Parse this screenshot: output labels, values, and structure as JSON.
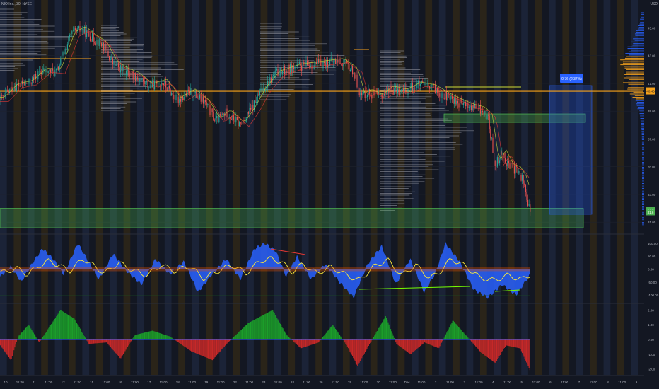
{
  "symbol_label": "NIO Inc., 30, NYSE",
  "currency": "USD",
  "price_axis": [
    {
      "v": 45,
      "label": "45.00"
    },
    {
      "v": 43,
      "label": "43.00"
    },
    {
      "v": 41,
      "label": "41.00"
    },
    {
      "v": 39,
      "label": "39.00"
    },
    {
      "v": 37,
      "label": "37.00"
    },
    {
      "v": 35,
      "label": "35.00"
    },
    {
      "v": 33,
      "label": "33.00"
    },
    {
      "v": 31,
      "label": "31.00"
    }
  ],
  "osc_axis": [
    {
      "v": 100,
      "label": "100.00"
    },
    {
      "v": 50,
      "label": "50.00"
    },
    {
      "v": 0,
      "label": "0.00"
    },
    {
      "v": -50,
      "label": "-50.00"
    },
    {
      "v": -100,
      "label": "-100.00"
    }
  ],
  "hist_axis": [
    {
      "v": 2,
      "label": "2.00"
    },
    {
      "v": 1,
      "label": "1.00"
    },
    {
      "v": 0,
      "label": "0.00"
    },
    {
      "v": -1,
      "label": "-1.00"
    },
    {
      "v": -2,
      "label": "-2.00"
    }
  ],
  "time_axis": [
    "10",
    "11:00",
    "11",
    "11:00",
    "12",
    "11:00",
    "15",
    "11:00",
    "16",
    "11:00",
    "17",
    "11:00",
    "18",
    "11:00",
    "19",
    "11:00",
    "22",
    "11:00",
    "23",
    "11:00",
    "24",
    "11:00",
    "26",
    "11:00",
    "29",
    "11:00",
    "30",
    "11:00",
    "Dec",
    "11:00",
    "2",
    "11:00",
    "3",
    "11:00",
    "4",
    "11:00",
    "5",
    "11:00",
    "6",
    "11:00",
    "7",
    "11:00",
    "8",
    "11:00",
    "9"
  ],
  "last_price": {
    "label": "40.46",
    "value": 40.46
  },
  "tag_price": {
    "label": "31.9",
    "value": 31.9
  },
  "tag_price2": {
    "label": "31.6",
    "value": 31.6
  },
  "position_label": "0.76 (2.37%)",
  "colors": {
    "up": "#26a69a",
    "down": "#ef5350",
    "level": "#f7a21b",
    "zone": "#4caf50",
    "profile": "#9598a1",
    "osc_blue": "#2962ff",
    "osc_yellow": "#ffeb3b",
    "hist_green": "#1b9e2a",
    "hist_red": "#c62828",
    "target": "#2962ff"
  },
  "chart_data": [
    {
      "type": "candlestick",
      "title": "NIO Inc., 30, NYSE",
      "ylim": [
        30.4,
        46.5
      ],
      "levels": [
        {
          "name": "",
          "value": 40.46
        },
        {
          "name": "",
          "value": 41.5
        }
      ],
      "zones": [
        {
          "name": "",
          "from": 30.6,
          "to": 32.0
        },
        {
          "name": "",
          "from": 38.2,
          "to": 38.6
        }
      ],
      "price_path_keypoints": [
        [
          0,
          39.8
        ],
        [
          20,
          40.8
        ],
        [
          40,
          41.0
        ],
        [
          60,
          41.9
        ],
        [
          80,
          41.8
        ],
        [
          100,
          44.5
        ],
        [
          115,
          44.9
        ],
        [
          130,
          44.3
        ],
        [
          145,
          43.8
        ],
        [
          160,
          42.4
        ],
        [
          175,
          41.9
        ],
        [
          190,
          41.6
        ],
        [
          210,
          40.8
        ],
        [
          230,
          41.1
        ],
        [
          250,
          39.8
        ],
        [
          270,
          40.4
        ],
        [
          290,
          39.6
        ],
        [
          305,
          38.3
        ],
        [
          320,
          38.9
        ],
        [
          340,
          38.0
        ],
        [
          355,
          39.1
        ],
        [
          370,
          40.5
        ],
        [
          390,
          41.7
        ],
        [
          420,
          42.2
        ],
        [
          450,
          42.4
        ],
        [
          480,
          42.6
        ],
        [
          500,
          41.9
        ],
        [
          510,
          40.1
        ],
        [
          520,
          40.4
        ],
        [
          535,
          40.0
        ],
        [
          550,
          40.6
        ],
        [
          570,
          40.4
        ],
        [
          590,
          40.9
        ],
        [
          610,
          40.7
        ],
        [
          630,
          40.1
        ],
        [
          650,
          39.6
        ],
        [
          665,
          39.3
        ],
        [
          680,
          39.1
        ],
        [
          690,
          38.6
        ],
        [
          700,
          35.2
        ],
        [
          710,
          36.0
        ],
        [
          720,
          35.0
        ],
        [
          730,
          34.8
        ],
        [
          740,
          34.0
        ],
        [
          750,
          31.6
        ]
      ]
    },
    {
      "type": "area",
      "name": "Oscillator",
      "ylim": [
        -130,
        130
      ],
      "keypoints": [
        [
          0,
          -30
        ],
        [
          15,
          10
        ],
        [
          30,
          -50
        ],
        [
          45,
          20
        ],
        [
          60,
          80
        ],
        [
          75,
          40
        ],
        [
          90,
          -20
        ],
        [
          110,
          100
        ],
        [
          125,
          30
        ],
        [
          140,
          -40
        ],
        [
          160,
          60
        ],
        [
          180,
          -10
        ],
        [
          200,
          -60
        ],
        [
          220,
          40
        ],
        [
          240,
          -20
        ],
        [
          260,
          30
        ],
        [
          280,
          -90
        ],
        [
          300,
          -20
        ],
        [
          320,
          40
        ],
        [
          340,
          -40
        ],
        [
          360,
          80
        ],
        [
          375,
          100
        ],
        [
          390,
          70
        ],
        [
          405,
          -30
        ],
        [
          420,
          50
        ],
        [
          440,
          -40
        ],
        [
          460,
          20
        ],
        [
          480,
          -50
        ],
        [
          500,
          -110
        ],
        [
          520,
          20
        ],
        [
          540,
          90
        ],
        [
          560,
          -60
        ],
        [
          580,
          40
        ],
        [
          600,
          -90
        ],
        [
          615,
          -20
        ],
        [
          630,
          100
        ],
        [
          650,
          30
        ],
        [
          670,
          -80
        ],
        [
          690,
          -110
        ],
        [
          710,
          -60
        ],
        [
          730,
          -100
        ],
        [
          750,
          -20
        ]
      ]
    },
    {
      "type": "bar",
      "name": "Histogram",
      "ylim": [
        -2.4,
        2.4
      ],
      "keypoints": [
        [
          0,
          -0.4
        ],
        [
          15,
          -1.4
        ],
        [
          25,
          0.2
        ],
        [
          40,
          1.0
        ],
        [
          55,
          -0.2
        ],
        [
          85,
          2.0
        ],
        [
          105,
          1.4
        ],
        [
          125,
          -0.3
        ],
        [
          150,
          -0.2
        ],
        [
          170,
          -1.3
        ],
        [
          190,
          0.3
        ],
        [
          215,
          0.6
        ],
        [
          240,
          0.2
        ],
        [
          270,
          -0.8
        ],
        [
          300,
          -1.4
        ],
        [
          320,
          -0.3
        ],
        [
          350,
          1.1
        ],
        [
          385,
          2.0
        ],
        [
          405,
          0.3
        ],
        [
          425,
          -0.6
        ],
        [
          450,
          -0.2
        ],
        [
          470,
          1.0
        ],
        [
          490,
          -0.4
        ],
        [
          505,
          -1.8
        ],
        [
          520,
          -0.5
        ],
        [
          545,
          1.6
        ],
        [
          560,
          -0.3
        ],
        [
          580,
          -1.0
        ],
        [
          600,
          -0.2
        ],
        [
          620,
          -0.6
        ],
        [
          640,
          1.3
        ],
        [
          660,
          0.2
        ],
        [
          680,
          -0.9
        ],
        [
          700,
          -1.6
        ],
        [
          715,
          -0.4
        ],
        [
          735,
          -0.6
        ],
        [
          750,
          -2.2
        ]
      ]
    }
  ]
}
